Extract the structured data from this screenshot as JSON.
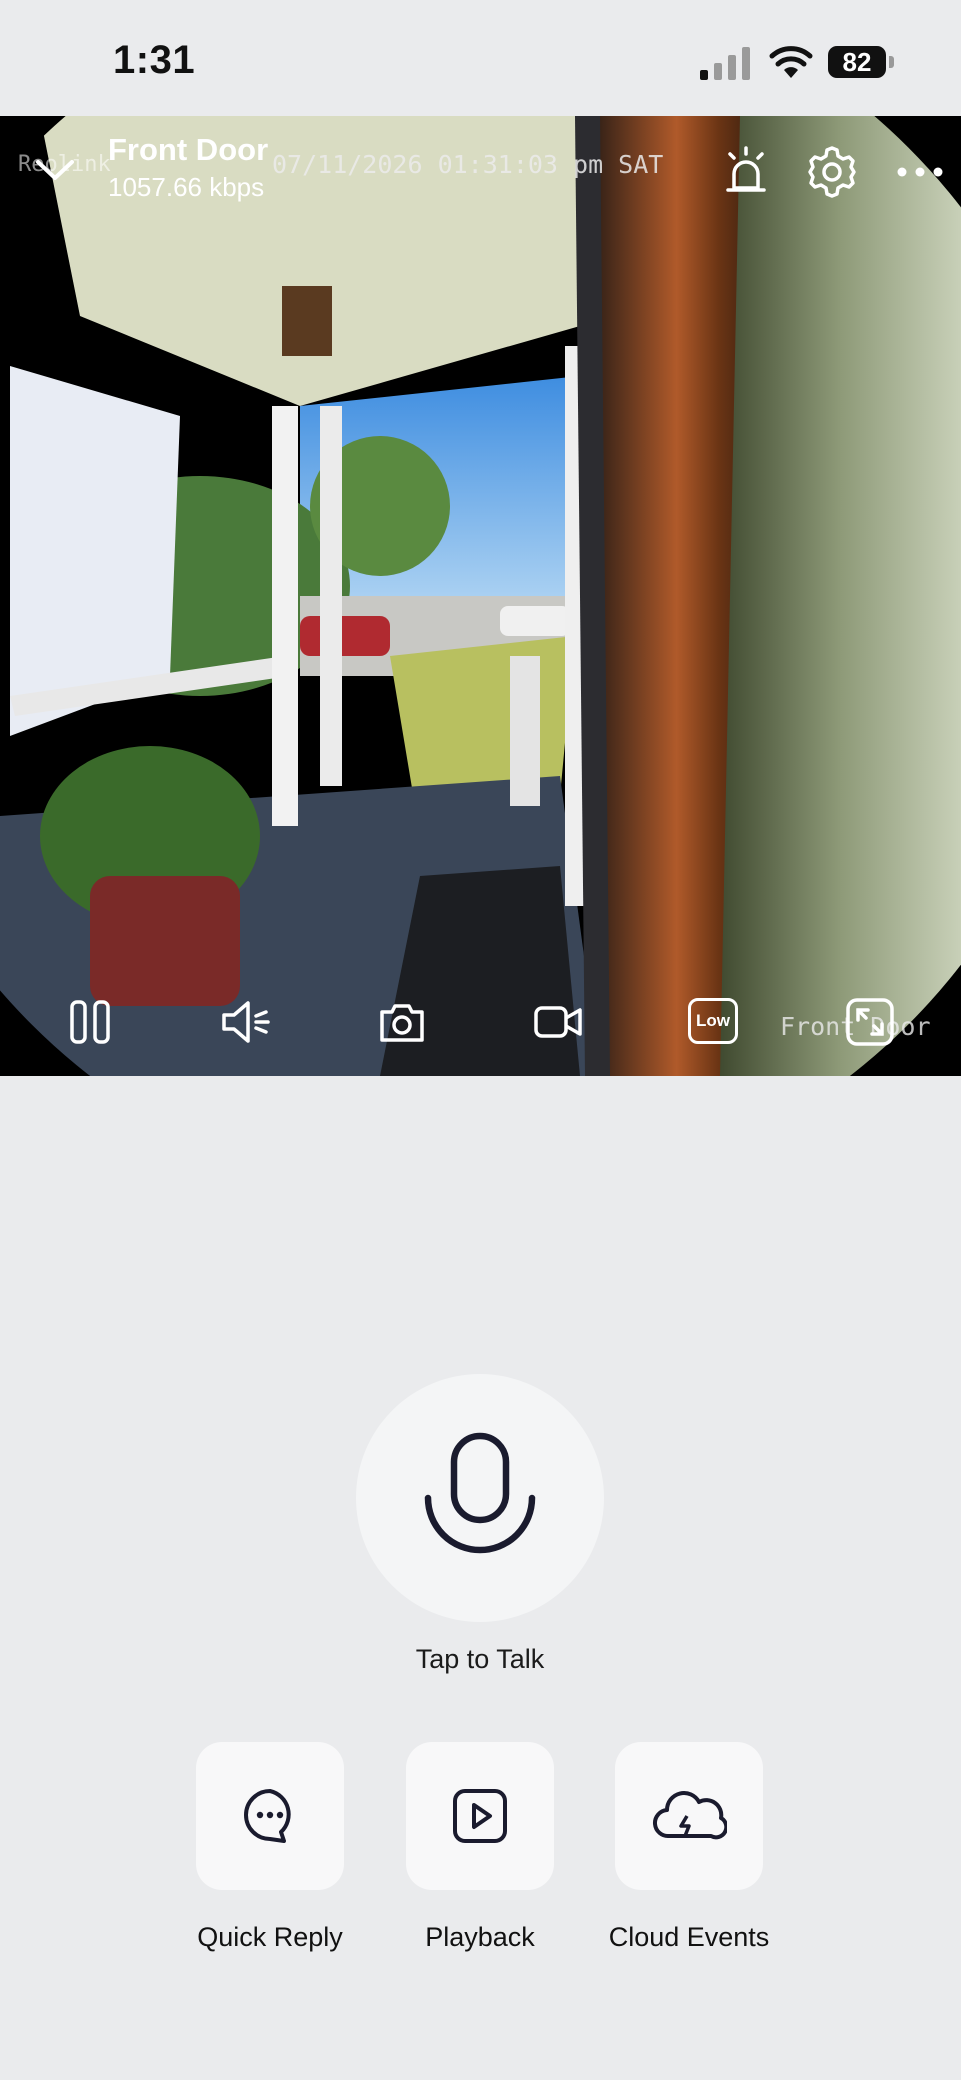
{
  "status_bar": {
    "time": "1:31",
    "battery": "82",
    "icons": [
      "cellular-signal-icon",
      "wifi-icon",
      "battery-icon"
    ]
  },
  "camera": {
    "watermark": "Reolink",
    "name": "Front Door",
    "bitrate": "1057.66 kbps",
    "timestamp": "07/11/2026 01:31:03 pm SAT",
    "overlay_label": "Front Door",
    "top_icons": [
      "chevron-down-icon",
      "siren-icon",
      "gear-icon",
      "more-icon"
    ],
    "controls": {
      "pause": "pause-icon",
      "speaker": "speaker-icon",
      "snapshot": "camera-icon",
      "record": "video-record-icon",
      "quality": "Low",
      "fullscreen": "fullscreen-icon"
    }
  },
  "talk": {
    "label": "Tap to Talk",
    "icon": "microphone-icon"
  },
  "actions": [
    {
      "label": "Quick Reply",
      "icon": "chat-bubble-icon"
    },
    {
      "label": "Playback",
      "icon": "play-icon"
    },
    {
      "label": "Cloud Events",
      "icon": "cloud-icon"
    }
  ],
  "colors": {
    "background": "#EAEBED",
    "button_bg": "#F8F8F9",
    "icon_dark": "#1A1B2E"
  }
}
